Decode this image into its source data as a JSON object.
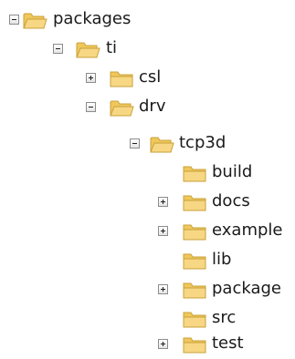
{
  "tree": [
    {
      "label": "packages",
      "icon": "folder-open-icon",
      "toggle": "expanded"
    },
    {
      "label": "ti",
      "icon": "folder-open-icon",
      "toggle": "expanded"
    },
    {
      "label": "csl",
      "icon": "folder-icon",
      "toggle": "collapsed"
    },
    {
      "label": "drv",
      "icon": "folder-open-icon",
      "toggle": "expanded"
    },
    {
      "label": "tcp3d",
      "icon": "folder-open-icon",
      "toggle": "expanded"
    },
    {
      "label": "build",
      "icon": "folder-icon",
      "toggle": "none"
    },
    {
      "label": "docs",
      "icon": "folder-icon",
      "toggle": "collapsed"
    },
    {
      "label": "example",
      "icon": "folder-icon",
      "toggle": "collapsed"
    },
    {
      "label": "lib",
      "icon": "folder-icon",
      "toggle": "none"
    },
    {
      "label": "package",
      "icon": "folder-icon",
      "toggle": "collapsed"
    },
    {
      "label": "src",
      "icon": "folder-icon",
      "toggle": "none"
    },
    {
      "label": "test",
      "icon": "folder-icon",
      "toggle": "collapsed"
    }
  ],
  "colors": {
    "folder_body": "#f7d784",
    "folder_tab": "#f0c75a",
    "folder_outline": "#c9a13b",
    "toggle_border": "#8c8c8c",
    "text": "#1a1a1a",
    "background": "#ffffff"
  }
}
